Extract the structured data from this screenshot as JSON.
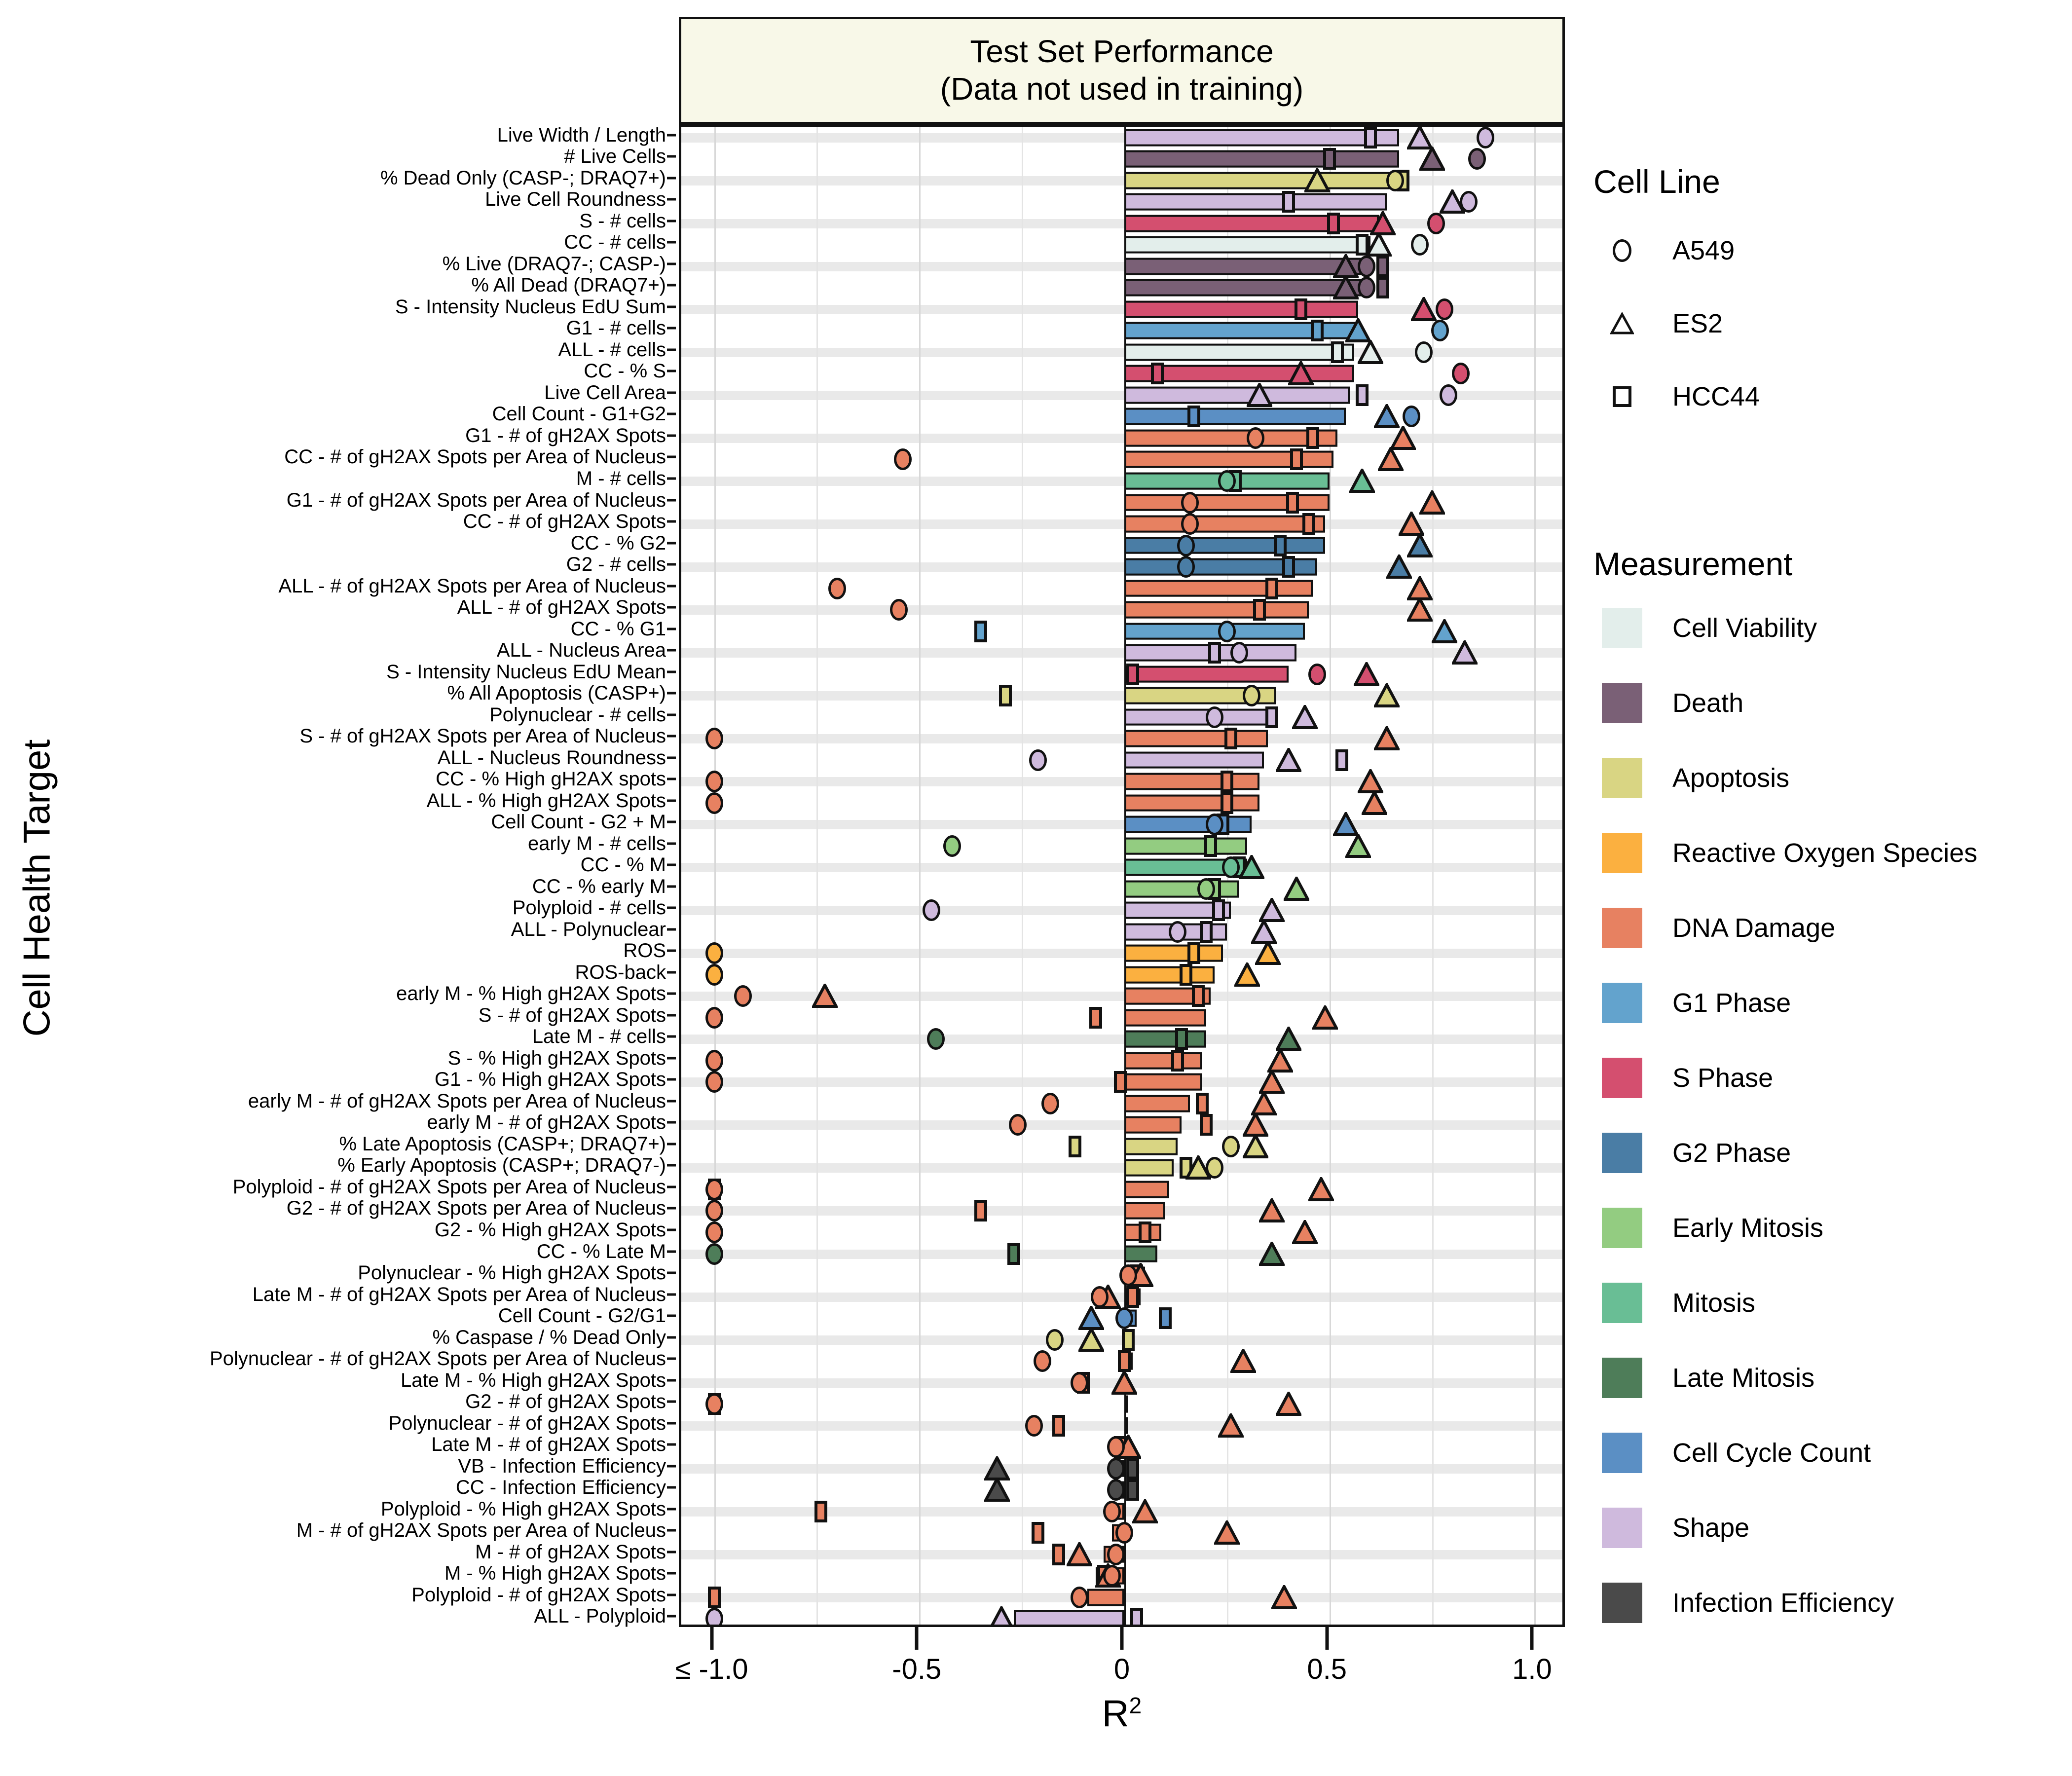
{
  "axes": {
    "y_title": "Cell Health Target",
    "x_title_base": "R",
    "x_title_sup": "2",
    "x_ticks": [
      "≤ -1.0",
      "-0.5",
      "0",
      "0.5",
      "1.0"
    ],
    "x_tick_values": [
      -1.0,
      -0.5,
      0,
      0.5,
      1.0
    ]
  },
  "panel": {
    "strip_line1": "Test Set Performance",
    "strip_line2": "(Data not used in training)"
  },
  "legends": {
    "cell_line": {
      "title": "Cell Line",
      "items": [
        {
          "label": "A549",
          "marker": "circle-marker"
        },
        {
          "label": "ES2",
          "marker": "triangle-marker"
        },
        {
          "label": "HCC44",
          "marker": "square-marker"
        }
      ]
    },
    "measurement": {
      "title": "Measurement",
      "items": [
        {
          "label": "Cell Viability",
          "color": "#e3eeeb"
        },
        {
          "label": "Death",
          "color": "#7a6076"
        },
        {
          "label": "Apoptosis",
          "color": "#d9d583"
        },
        {
          "label": "Reactive Oxygen Species",
          "color": "#fcb council"
        },
        {
          "label": "DNA Damage",
          "color": "#e78161"
        },
        {
          "label": "G1 Phase",
          "color": "#63a3cd"
        },
        {
          "label": "S Phase",
          "color": "#d44f6f"
        },
        {
          "label": "G2 Phase",
          "color": "#4a7da5"
        },
        {
          "label": "Early Mitosis",
          "color": "#93cc81"
        },
        {
          "label": "Mitosis",
          "color": "#69be95"
        },
        {
          "label": "Late Mitosis",
          "color": "#4e7d59"
        },
        {
          "label": "Cell Cycle Count",
          "color": "#5b8fc4"
        },
        {
          "label": "Shape",
          "color": "#cfbadd"
        },
        {
          "label": "Infection Efficiency",
          "color": "#4a4a4a"
        }
      ]
    }
  },
  "chart_data": {
    "type": "bar",
    "title": "Test Set Performance (Data not used in training)",
    "xlabel": "R^2",
    "ylabel": "Cell Health Target",
    "xlim": [
      -1.08,
      1.08
    ],
    "grid": true,
    "legend_position": "right",
    "orientation": "horizontal",
    "bar_meaning": "mean R-squared across cell lines",
    "point_meaning": "per cell line R-squared",
    "point_series": [
      "A549",
      "ES2",
      "HCC44"
    ],
    "color_key": "measurement",
    "rows": [
      {
        "target": "Live Width / Length",
        "measurement": "Shape",
        "bar": 0.67,
        "A549": 0.88,
        "ES2": 0.72,
        "HCC44": 0.6
      },
      {
        "target": "# Live Cells",
        "measurement": "Death",
        "bar": 0.67,
        "A549": 0.86,
        "ES2": 0.75,
        "HCC44": 0.5
      },
      {
        "target": "% Dead Only (CASP-; DRAQ7+)",
        "measurement": "Apoptosis",
        "bar": 0.65,
        "A549": 0.66,
        "ES2": 0.47,
        "HCC44": 0.68
      },
      {
        "target": "Live Cell Roundness",
        "measurement": "Shape",
        "bar": 0.64,
        "A549": 0.84,
        "ES2": 0.8,
        "HCC44": 0.4
      },
      {
        "target": "S - # cells",
        "measurement": "S Phase",
        "bar": 0.62,
        "A549": 0.76,
        "ES2": 0.63,
        "HCC44": 0.51
      },
      {
        "target": "CC - # cells",
        "measurement": "Cell Viability",
        "bar": 0.6,
        "A549": 0.72,
        "ES2": 0.62,
        "HCC44": 0.58
      },
      {
        "target": "% Live (DRAQ7-; CASP-)",
        "measurement": "Death",
        "bar": 0.58,
        "A549": 0.59,
        "ES2": 0.54,
        "HCC44": 0.63
      },
      {
        "target": "% All Dead (DRAQ7+)",
        "measurement": "Death",
        "bar": 0.58,
        "A549": 0.59,
        "ES2": 0.54,
        "HCC44": 0.63
      },
      {
        "target": "S - Intensity Nucleus EdU Sum",
        "measurement": "S Phase",
        "bar": 0.57,
        "A549": 0.78,
        "ES2": 0.73,
        "HCC44": 0.43
      },
      {
        "target": "G1 - # cells",
        "measurement": "G1 Phase",
        "bar": 0.57,
        "A549": 0.77,
        "ES2": 0.57,
        "HCC44": 0.47
      },
      {
        "target": "ALL - # cells",
        "measurement": "Cell Viability",
        "bar": 0.56,
        "A549": 0.73,
        "ES2": 0.6,
        "HCC44": 0.52
      },
      {
        "target": "CC - % S",
        "measurement": "S Phase",
        "bar": 0.56,
        "A549": 0.82,
        "ES2": 0.43,
        "HCC44": 0.08
      },
      {
        "target": "Live Cell Area",
        "measurement": "Shape",
        "bar": 0.55,
        "A549": 0.79,
        "ES2": 0.33,
        "HCC44": 0.58
      },
      {
        "target": "Cell Count - G1+G2",
        "measurement": "Cell Cycle Count",
        "bar": 0.54,
        "A549": 0.7,
        "ES2": 0.64,
        "HCC44": 0.17
      },
      {
        "target": "G1 - # of gH2AX Spots",
        "measurement": "DNA Damage",
        "bar": 0.52,
        "A549": 0.32,
        "ES2": 0.68,
        "HCC44": 0.46
      },
      {
        "target": "CC - # of gH2AX Spots per Area of Nucleus",
        "measurement": "DNA Damage",
        "bar": 0.51,
        "A549": -0.54,
        "ES2": 0.65,
        "HCC44": 0.42
      },
      {
        "target": "M - # cells",
        "measurement": "Mitosis",
        "bar": 0.5,
        "A549": 0.25,
        "ES2": 0.58,
        "HCC44": 0.27
      },
      {
        "target": "G1 - # of gH2AX Spots per Area of Nucleus",
        "measurement": "DNA Damage",
        "bar": 0.5,
        "A549": 0.16,
        "ES2": 0.75,
        "HCC44": 0.41
      },
      {
        "target": "CC - # of gH2AX Spots",
        "measurement": "DNA Damage",
        "bar": 0.49,
        "A549": 0.16,
        "ES2": 0.7,
        "HCC44": 0.45
      },
      {
        "target": "CC - % G2",
        "measurement": "G2 Phase",
        "bar": 0.49,
        "A549": 0.15,
        "ES2": 0.72,
        "HCC44": 0.38
      },
      {
        "target": "G2 - # cells",
        "measurement": "G2 Phase",
        "bar": 0.47,
        "A549": 0.15,
        "ES2": 0.67,
        "HCC44": 0.4
      },
      {
        "target": "ALL - # of gH2AX Spots per Area of Nucleus",
        "measurement": "DNA Damage",
        "bar": 0.46,
        "A549": -0.7,
        "ES2": 0.72,
        "HCC44": 0.36
      },
      {
        "target": "ALL - # of gH2AX Spots",
        "measurement": "DNA Damage",
        "bar": 0.45,
        "A549": -0.55,
        "ES2": 0.72,
        "HCC44": 0.33
      },
      {
        "target": "CC - % G1",
        "measurement": "G1 Phase",
        "bar": 0.44,
        "A549": 0.25,
        "ES2": 0.78,
        "HCC44": -0.35
      },
      {
        "target": "ALL - Nucleus Area",
        "measurement": "Shape",
        "bar": 0.42,
        "A549": 0.28,
        "ES2": 0.83,
        "HCC44": 0.22
      },
      {
        "target": "S - Intensity Nucleus EdU Mean",
        "measurement": "S Phase",
        "bar": 0.4,
        "A549": 0.47,
        "ES2": 0.59,
        "HCC44": 0.02
      },
      {
        "target": "% All Apoptosis (CASP+)",
        "measurement": "Apoptosis",
        "bar": 0.37,
        "A549": 0.31,
        "ES2": 0.64,
        "HCC44": -0.29
      },
      {
        "target": "Polynuclear - # cells",
        "measurement": "Shape",
        "bar": 0.36,
        "A549": 0.22,
        "ES2": 0.44,
        "HCC44": 0.36
      },
      {
        "target": "S - # of gH2AX Spots per Area of Nucleus",
        "measurement": "DNA Damage",
        "bar": 0.35,
        "A549": -1.0,
        "ES2": 0.64,
        "HCC44": 0.26
      },
      {
        "target": "ALL - Nucleus Roundness",
        "measurement": "Shape",
        "bar": 0.34,
        "A549": -0.21,
        "ES2": 0.4,
        "HCC44": 0.53
      },
      {
        "target": "CC - % High gH2AX spots",
        "measurement": "DNA Damage",
        "bar": 0.33,
        "A549": -1.0,
        "ES2": 0.6,
        "HCC44": 0.25
      },
      {
        "target": "ALL - % High gH2AX Spots",
        "measurement": "DNA Damage",
        "bar": 0.33,
        "A549": -1.0,
        "ES2": 0.61,
        "HCC44": 0.25
      },
      {
        "target": "Cell Count - G2 + M",
        "measurement": "Cell Cycle Count",
        "bar": 0.31,
        "A549": 0.22,
        "ES2": 0.54,
        "HCC44": 0.24
      },
      {
        "target": "early M - # cells",
        "measurement": "Early Mitosis",
        "bar": 0.3,
        "A549": -0.42,
        "ES2": 0.57,
        "HCC44": 0.21
      },
      {
        "target": "CC - % M",
        "measurement": "Mitosis",
        "bar": 0.3,
        "A549": 0.26,
        "ES2": 0.31,
        "HCC44": 0.28
      },
      {
        "target": "CC - % early M",
        "measurement": "Early Mitosis",
        "bar": 0.28,
        "A549": 0.2,
        "ES2": 0.42,
        "HCC44": 0.22
      },
      {
        "target": "Polyploid - # cells",
        "measurement": "Shape",
        "bar": 0.26,
        "A549": -0.47,
        "ES2": 0.36,
        "HCC44": 0.23
      },
      {
        "target": "ALL - Polynuclear",
        "measurement": "Shape",
        "bar": 0.25,
        "A549": 0.13,
        "ES2": 0.34,
        "HCC44": 0.2
      },
      {
        "target": "ROS",
        "measurement": "Reactive Oxygen Species",
        "bar": 0.24,
        "A549": -1.0,
        "ES2": 0.35,
        "HCC44": 0.17
      },
      {
        "target": "ROS-back",
        "measurement": "Reactive Oxygen Species",
        "bar": 0.22,
        "A549": -1.0,
        "ES2": 0.3,
        "HCC44": 0.15
      },
      {
        "target": "early M - % High gH2AX Spots",
        "measurement": "DNA Damage",
        "bar": 0.21,
        "A549": -0.93,
        "ES2": -0.73,
        "HCC44": 0.18
      },
      {
        "target": "S - # of gH2AX Spots",
        "measurement": "DNA Damage",
        "bar": 0.2,
        "A549": -1.0,
        "ES2": 0.49,
        "HCC44": -0.07
      },
      {
        "target": "Late M - # cells",
        "measurement": "Late Mitosis",
        "bar": 0.2,
        "A549": -0.46,
        "ES2": 0.4,
        "HCC44": 0.14
      },
      {
        "target": "S - % High gH2AX Spots",
        "measurement": "DNA Damage",
        "bar": 0.19,
        "A549": -1.0,
        "ES2": 0.38,
        "HCC44": 0.13
      },
      {
        "target": "G1 - % High gH2AX Spots",
        "measurement": "DNA Damage",
        "bar": 0.19,
        "A549": -1.0,
        "ES2": 0.36,
        "HCC44": -0.01
      },
      {
        "target": "early M - # of gH2AX Spots per Area of Nucleus",
        "measurement": "DNA Damage",
        "bar": 0.16,
        "A549": -0.18,
        "ES2": 0.34,
        "HCC44": 0.19
      },
      {
        "target": "early M - # of gH2AX Spots",
        "measurement": "DNA Damage",
        "bar": 0.14,
        "A549": -0.26,
        "ES2": 0.32,
        "HCC44": 0.2
      },
      {
        "target": "% Late Apoptosis (CASP+; DRAQ7+)",
        "measurement": "Apoptosis",
        "bar": 0.13,
        "A549": 0.26,
        "ES2": 0.32,
        "HCC44": -0.12
      },
      {
        "target": "% Early Apoptosis (CASP+; DRAQ7-)",
        "measurement": "Apoptosis",
        "bar": 0.12,
        "A549": 0.22,
        "ES2": 0.18,
        "HCC44": 0.15
      },
      {
        "target": "Polyploid - # of gH2AX Spots per Area of Nucleus",
        "measurement": "DNA Damage",
        "bar": 0.11,
        "A549": -1.0,
        "ES2": 0.48,
        "HCC44": -1.0
      },
      {
        "target": "G2 - # of gH2AX Spots per Area of Nucleus",
        "measurement": "DNA Damage",
        "bar": 0.1,
        "A549": -1.0,
        "ES2": 0.36,
        "HCC44": -0.35
      },
      {
        "target": "G2 - % High gH2AX Spots",
        "measurement": "DNA Damage",
        "bar": 0.09,
        "A549": -1.0,
        "ES2": 0.44,
        "HCC44": 0.05
      },
      {
        "target": "CC - % Late M",
        "measurement": "Late Mitosis",
        "bar": 0.08,
        "A549": -1.0,
        "ES2": 0.36,
        "HCC44": -0.27
      },
      {
        "target": "Polynuclear - % High gH2AX Spots",
        "measurement": "DNA Damage",
        "bar": 0.05,
        "A549": 0.01,
        "ES2": 0.04,
        "HCC44": 0.03
      },
      {
        "target": "Late M - # of gH2AX Spots per Area of Nucleus",
        "measurement": "DNA Damage",
        "bar": 0.04,
        "A549": -0.06,
        "ES2": -0.04,
        "HCC44": 0.02
      },
      {
        "target": "Cell Count - G2/G1",
        "measurement": "Cell Cycle Count",
        "bar": 0.03,
        "A549": 0.0,
        "ES2": -0.08,
        "HCC44": 0.1
      },
      {
        "target": "% Caspase / % Dead Only",
        "measurement": "Apoptosis",
        "bar": 0.02,
        "A549": -0.17,
        "ES2": -0.08,
        "HCC44": 0.01
      },
      {
        "target": "Polynuclear - # of gH2AX Spots per Area of Nucleus",
        "measurement": "DNA Damage",
        "bar": 0.02,
        "A549": -0.2,
        "ES2": 0.29,
        "HCC44": 0.0
      },
      {
        "target": "Late M - % High gH2AX Spots",
        "measurement": "DNA Damage",
        "bar": 0.01,
        "A549": -0.11,
        "ES2": 0.0,
        "HCC44": -0.1
      },
      {
        "target": "G2 - # of gH2AX Spots",
        "measurement": "DNA Damage",
        "bar": 0.01,
        "A549": -1.0,
        "ES2": 0.4,
        "HCC44": -1.0
      },
      {
        "target": "Polynuclear - # of gH2AX Spots",
        "measurement": "DNA Damage",
        "bar": 0.0,
        "A549": -0.22,
        "ES2": 0.26,
        "HCC44": -0.16
      },
      {
        "target": "Late M - # of gH2AX Spots",
        "measurement": "DNA Damage",
        "bar": 0.0,
        "A549": -0.02,
        "ES2": 0.01,
        "HCC44": -0.01
      },
      {
        "target": "VB - Infection Efficiency",
        "measurement": "Infection Efficiency",
        "bar": -0.01,
        "A549": -0.02,
        "ES2": -0.31,
        "HCC44": 0.02
      },
      {
        "target": "CC - Infection Efficiency",
        "measurement": "Infection Efficiency",
        "bar": -0.01,
        "A549": -0.02,
        "ES2": -0.31,
        "HCC44": 0.02
      },
      {
        "target": "Polyploid - % High gH2AX Spots",
        "measurement": "DNA Damage",
        "bar": -0.02,
        "A549": -0.03,
        "ES2": 0.05,
        "HCC44": -0.74
      },
      {
        "target": "M - # of gH2AX Spots per Area of Nucleus",
        "measurement": "DNA Damage",
        "bar": -0.03,
        "A549": 0.0,
        "ES2": 0.25,
        "HCC44": -0.21
      },
      {
        "target": "M - # of gH2AX Spots",
        "measurement": "DNA Damage",
        "bar": -0.05,
        "A549": -0.02,
        "ES2": -0.11,
        "HCC44": -0.16
      },
      {
        "target": "M - % High gH2AX Spots",
        "measurement": "DNA Damage",
        "bar": -0.07,
        "A549": -0.03,
        "ES2": -0.04,
        "HCC44": -0.05
      },
      {
        "target": "Polyploid - # of gH2AX Spots",
        "measurement": "DNA Damage",
        "bar": -0.09,
        "A549": -0.11,
        "ES2": 0.39,
        "HCC44": -1.0
      },
      {
        "target": "ALL - Polyploid",
        "measurement": "Shape",
        "bar": -0.27,
        "A549": -1.0,
        "ES2": -0.3,
        "HCC44": 0.03
      }
    ]
  }
}
